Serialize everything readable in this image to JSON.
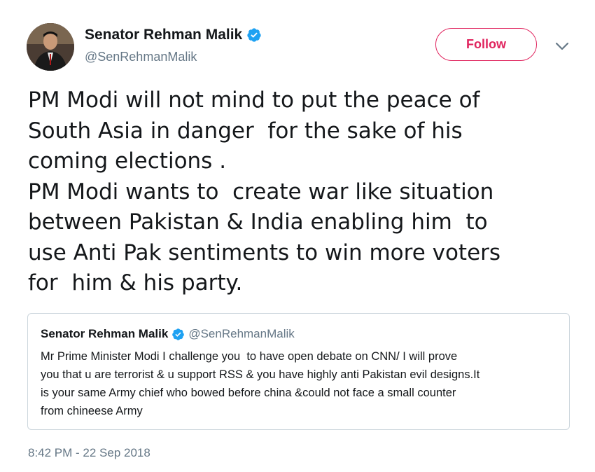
{
  "author": {
    "name": "Senator Rehman Malik",
    "handle": "@SenRehmanMalik",
    "verified": true
  },
  "follow_label": "Follow",
  "tweet_lines": [
    "PM Modi will not mind to put the peace of",
    "South Asia in danger  for the sake of his",
    "coming elections .",
    "PM Modi wants to  create war like situation",
    "between Pakistan & India enabling him  to",
    "use Anti Pak sentiments to win more voters",
    "for  him & his party."
  ],
  "quoted_tweet": {
    "name": "Senator Rehman Malik",
    "handle": "@SenRehmanMalik",
    "lines": [
      "Mr Prime Minister Modi I challenge you  to have open debate on CNN/ I will prove",
      "you that u are terrorist & u support RSS & you have highly anti Pakistan evil designs.It",
      "is your same Army chief who bowed before china &could not face a small counter",
      "from chineese Army"
    ]
  },
  "timestamp": "8:42 PM - 22 Sep 2018",
  "colors": {
    "follow_accent": "#e0245e",
    "verified_blue": "#1da1f2",
    "secondary_text": "#657786",
    "border": "#ccd6dd"
  }
}
